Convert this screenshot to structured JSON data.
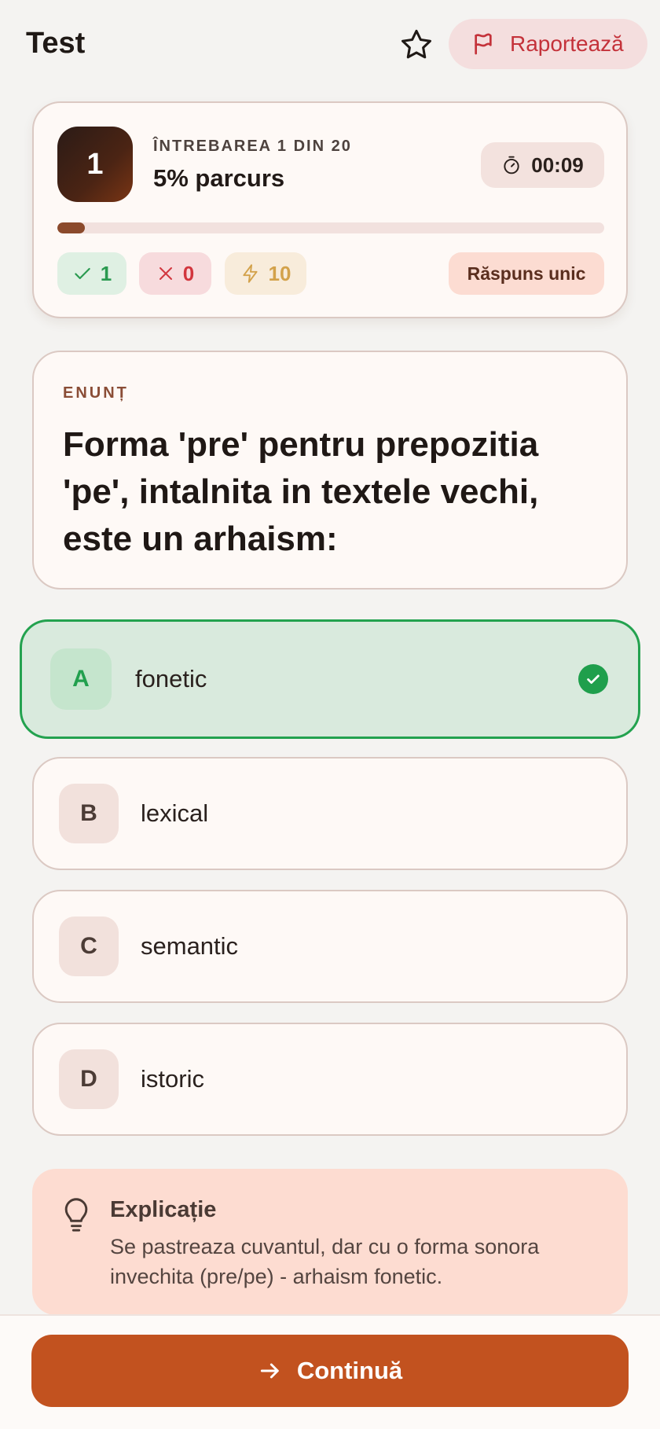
{
  "header": {
    "title": "Test",
    "report_label": "Raportează"
  },
  "progress": {
    "question_number": "1",
    "counter_label": "ÎNTREBAREA 1 DIN 20",
    "percent_label": "5% parcurs",
    "percent_value": 5,
    "timer": "00:09",
    "correct_count": "1",
    "wrong_count": "0",
    "xp": "10",
    "answer_type": "Răspuns unic"
  },
  "statement": {
    "label": "ENUNȚ",
    "text": "Forma 'pre' pentru prepozitia 'pe', intalnita in textele vechi, este un arhaism:"
  },
  "answers": [
    {
      "letter": "A",
      "text": "fonetic",
      "selected": true
    },
    {
      "letter": "B",
      "text": "lexical",
      "selected": false
    },
    {
      "letter": "C",
      "text": "semantic",
      "selected": false
    },
    {
      "letter": "D",
      "text": "istoric",
      "selected": false
    }
  ],
  "explanation": {
    "title": "Explicație",
    "body": "Se pastreaza cuvantul, dar cu o forma sonora invechita (pre/pe) - arhaism fonetic."
  },
  "footer": {
    "continue_label": "Continuă"
  },
  "colors": {
    "accent": "#c2521f",
    "correct": "#23a24f",
    "wrong": "#d2363e"
  }
}
